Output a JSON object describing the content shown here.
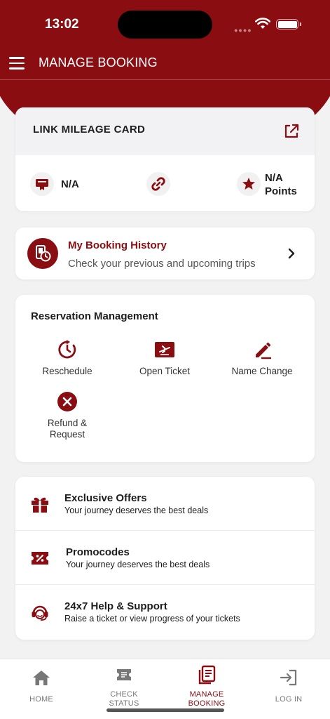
{
  "status_bar": {
    "time": "13:02"
  },
  "header": {
    "title": "MANAGE BOOKING"
  },
  "mileage_card": {
    "title": "LINK MILEAGE CARD",
    "card_value": "N/A",
    "points_value": "N/A",
    "points_label": "Points"
  },
  "booking_history": {
    "title": "My Booking History",
    "subtitle": "Check your previous and upcoming trips"
  },
  "reservation": {
    "title": "Reservation Management",
    "items": [
      {
        "label": "Reschedule",
        "icon": "reschedule-icon"
      },
      {
        "label": "Open Ticket",
        "icon": "ticket-plane-icon"
      },
      {
        "label": "Name Change",
        "icon": "edit-pen-icon"
      },
      {
        "label": "Refund &\nRequest",
        "icon": "cancel-x-icon"
      }
    ]
  },
  "offers": [
    {
      "title": "Exclusive Offers",
      "subtitle": "Your journey deserves the best deals",
      "icon": "gift-icon"
    },
    {
      "title": "Promocodes",
      "subtitle": "Your journey deserves the best deals",
      "icon": "discount-ticket-icon"
    },
    {
      "title": "24x7 Help & Support",
      "subtitle": "Raise a ticket or view progress of your tickets",
      "icon": "support-agent-icon"
    }
  ],
  "bottom_nav": [
    {
      "label": "HOME",
      "icon": "home-icon",
      "active": false
    },
    {
      "label": "CHECK\nSTATUS",
      "icon": "ticket-icon",
      "active": false
    },
    {
      "label": "MANAGE\nBOOKING",
      "icon": "booking-list-icon",
      "active": true
    },
    {
      "label": "LOG IN",
      "icon": "login-icon",
      "active": false
    }
  ],
  "colors": {
    "brand": "#8a0d12",
    "background": "#f2f2f2",
    "card": "#ffffff"
  }
}
